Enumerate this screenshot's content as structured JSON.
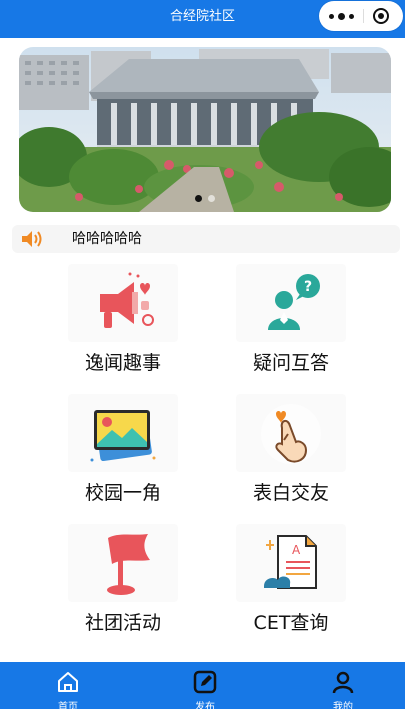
{
  "header": {
    "title": "合经院社区"
  },
  "notice": {
    "text": "哈哈哈哈哈"
  },
  "grid": [
    {
      "label": "逸闻趣事"
    },
    {
      "label": "疑问互答"
    },
    {
      "label": "校园一角"
    },
    {
      "label": "表白交友"
    },
    {
      "label": "社团活动"
    },
    {
      "label": "CET查询"
    }
  ],
  "tabs": [
    {
      "label": "首页"
    },
    {
      "label": "发布"
    },
    {
      "label": "我的"
    }
  ],
  "colors": {
    "brand": "#1778e6",
    "accent": "#f08a24"
  }
}
